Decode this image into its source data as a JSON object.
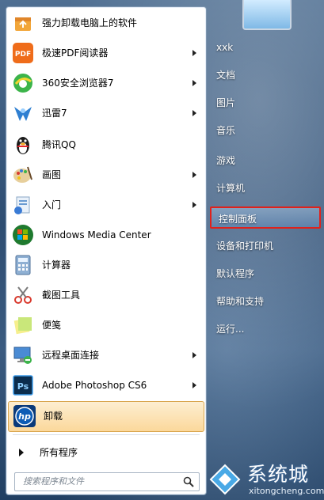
{
  "programs": [
    {
      "label": "强力卸载电脑上的软件",
      "has_arrow": false,
      "icon": "uninstall-box-icon"
    },
    {
      "label": "极速PDF阅读器",
      "has_arrow": true,
      "icon": "pdf-reader-icon"
    },
    {
      "label": "360安全浏览器7",
      "has_arrow": true,
      "icon": "360-browser-icon"
    },
    {
      "label": "迅雷7",
      "has_arrow": true,
      "icon": "thunder-icon"
    },
    {
      "label": "腾讯QQ",
      "has_arrow": false,
      "icon": "qq-penguin-icon"
    },
    {
      "label": "画图",
      "has_arrow": true,
      "icon": "paint-palette-icon"
    },
    {
      "label": "入门",
      "has_arrow": true,
      "icon": "getting-started-icon"
    },
    {
      "label": "Windows Media Center",
      "has_arrow": false,
      "icon": "windows-logo-icon"
    },
    {
      "label": "计算器",
      "has_arrow": false,
      "icon": "calculator-icon"
    },
    {
      "label": "截图工具",
      "has_arrow": false,
      "icon": "snipping-tool-icon"
    },
    {
      "label": "便笺",
      "has_arrow": false,
      "icon": "sticky-notes-icon"
    },
    {
      "label": "远程桌面连接",
      "has_arrow": true,
      "icon": "remote-desktop-icon"
    },
    {
      "label": "Adobe Photoshop CS6",
      "has_arrow": true,
      "icon": "photoshop-icon"
    },
    {
      "label": "卸载",
      "has_arrow": false,
      "icon": "hp-logo-icon"
    }
  ],
  "all_programs": "所有程序",
  "search": {
    "placeholder": "搜索程序和文件"
  },
  "right_items": [
    "xxk",
    "文档",
    "图片",
    "音乐",
    "游戏",
    "计算机",
    "控制面板",
    "设备和打印机",
    "默认程序",
    "帮助和支持",
    "运行..."
  ],
  "selected_right_item": "控制面板",
  "watermark": {
    "title": "系统城",
    "url": "xitongcheng.com"
  },
  "colors": {
    "highlight_border": "#e0211b",
    "hover_item": "#fbd89b"
  }
}
